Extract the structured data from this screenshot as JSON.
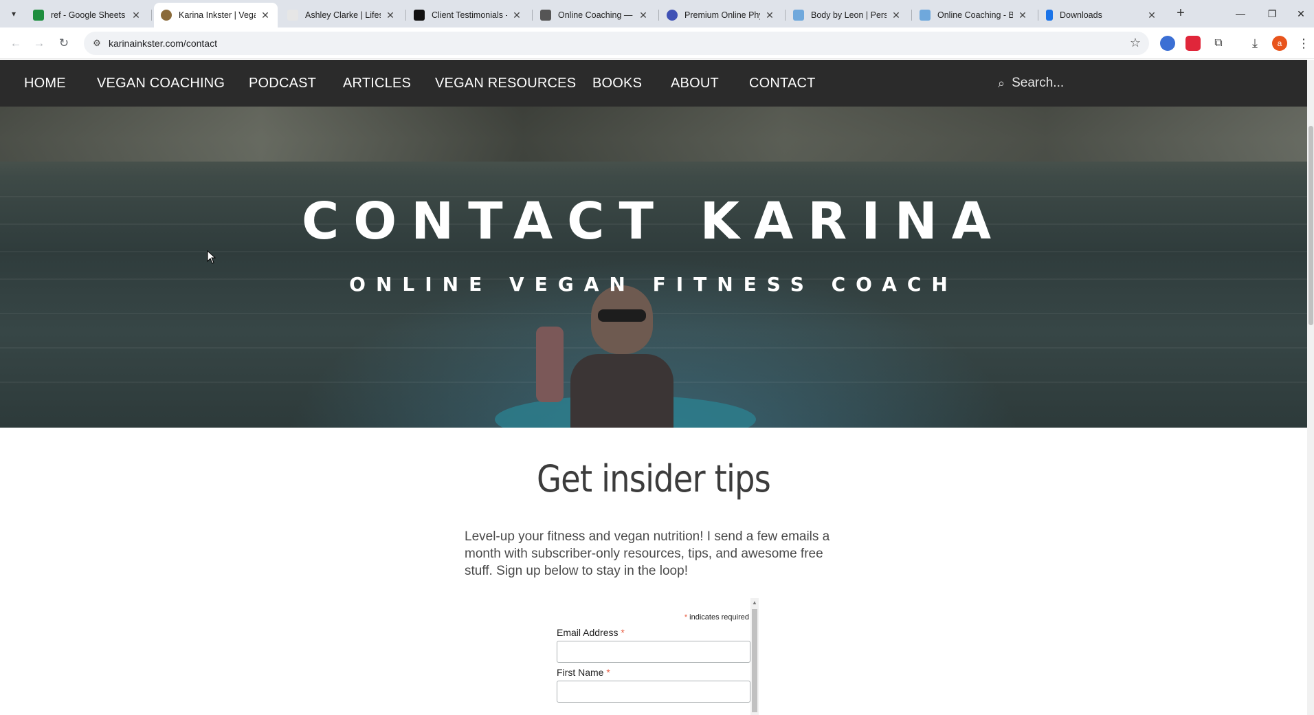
{
  "browser": {
    "tabs": [
      {
        "title": "ref - Google Sheets",
        "favicon_color": "#1e8e3e",
        "active": false
      },
      {
        "title": "Karina Inkster | Vegan",
        "favicon_color": "#8a6a3a",
        "active": true
      },
      {
        "title": "Ashley Clarke | Lifesty",
        "favicon_color": "#e0e0e0",
        "active": false
      },
      {
        "title": "Client Testimonials - F",
        "favicon_color": "#000000",
        "active": false
      },
      {
        "title": "Online Coaching — E",
        "favicon_color": "#555555",
        "active": false
      },
      {
        "title": "Premium Online Phys",
        "favicon_color": "#3f51b5",
        "active": false
      },
      {
        "title": "Body by Leon | Perso",
        "favicon_color": "#6fa8dc",
        "active": false
      },
      {
        "title": "Online Coaching - Bo",
        "favicon_color": "#6fa8dc",
        "active": false
      },
      {
        "title": "Downloads",
        "favicon_color": "#1a73e8",
        "active": false
      }
    ],
    "url": "karinainkster.com/contact",
    "icons": {
      "tab_search": "▾",
      "close": "✕",
      "new_tab": "+",
      "minimize": "—",
      "restore": "❐",
      "window_close": "✕",
      "back": "←",
      "forward": "→",
      "reload": "↻",
      "site_info": "⚙",
      "bookmark": "☆",
      "download": "⤓",
      "menu": "⋮",
      "puzzle": "⧉",
      "profile_initial": "a"
    }
  },
  "site": {
    "nav": [
      "HOME",
      "VEGAN COACHING",
      "PODCAST",
      "ARTICLES",
      "VEGAN RESOURCES",
      "BOOKS",
      "ABOUT",
      "CONTACT"
    ],
    "search_placeholder": "Search...",
    "hero_title": "CONTACT KARINA",
    "hero_subtitle": "ONLINE VEGAN FITNESS COACH",
    "section_heading": "Get insider tips",
    "intro_text": "Level-up your fitness and vegan nutrition! I send a few emails a month with subscriber-only resources, tips, and awesome free stuff. Sign up below to stay in the loop!",
    "form": {
      "required_note": "indicates required",
      "required_mark": "*",
      "email_label": "Email Address",
      "first_name_label": "First Name",
      "email_value": "",
      "first_name_value": ""
    }
  }
}
